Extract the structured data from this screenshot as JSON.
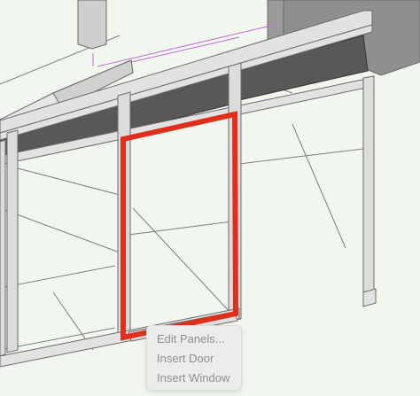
{
  "scene": {
    "name": "3D wall framing viewport",
    "selected_object": "panel opening"
  },
  "colors": {
    "background": "#f1f6ef",
    "header_panel": "#585858",
    "frame": "#d9d9d9",
    "frame_edge": "#6a6a6a",
    "selection": "#e02e1a",
    "menu_bg": "#ececea",
    "menu_text_disabled": "#8f8f8f"
  },
  "context_menu": {
    "items": [
      {
        "label": "Edit Panels...",
        "enabled": false
      },
      {
        "label": "Insert Door",
        "enabled": false
      },
      {
        "label": "Insert Window",
        "enabled": false
      }
    ]
  }
}
